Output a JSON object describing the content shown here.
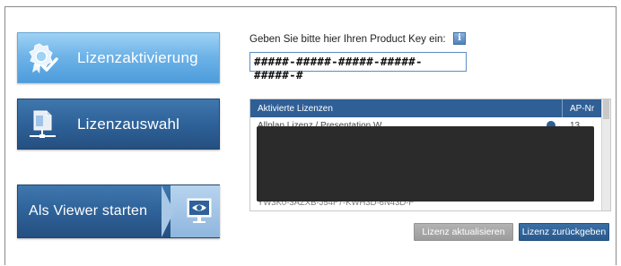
{
  "nav": {
    "activate_label": "Lizenzaktivierung",
    "select_label": "Lizenzauswahl",
    "viewer_label": "Als Viewer starten"
  },
  "key": {
    "label": "Geben Sie bitte hier Ihren Product Key ein:",
    "info_glyph": "i",
    "value": "#####-#####-#####-#####-#####-#"
  },
  "table": {
    "columns": [
      "Aktivierte Lizenzen",
      "AP-Nr"
    ],
    "rows": [
      {
        "name": "Allplan Lizenz / Presentation W...",
        "ap": "13"
      },
      {
        "name": "YW3K0-3AZXB-J54F7-KWH3D-6N43D-F",
        "ap": ""
      }
    ]
  },
  "actions": {
    "refresh_label": "Lizenz aktualisieren",
    "return_label": "Lizenz zurückgeben"
  },
  "colors": {
    "accent_dark": "#2f5f95",
    "accent_light": "#6fb4e8",
    "disabled": "#a6a6a6"
  },
  "icons": {
    "activate": "badge-check-icon",
    "select": "network-document-icon",
    "viewer": "monitor-eye-icon",
    "info": "info-icon"
  }
}
